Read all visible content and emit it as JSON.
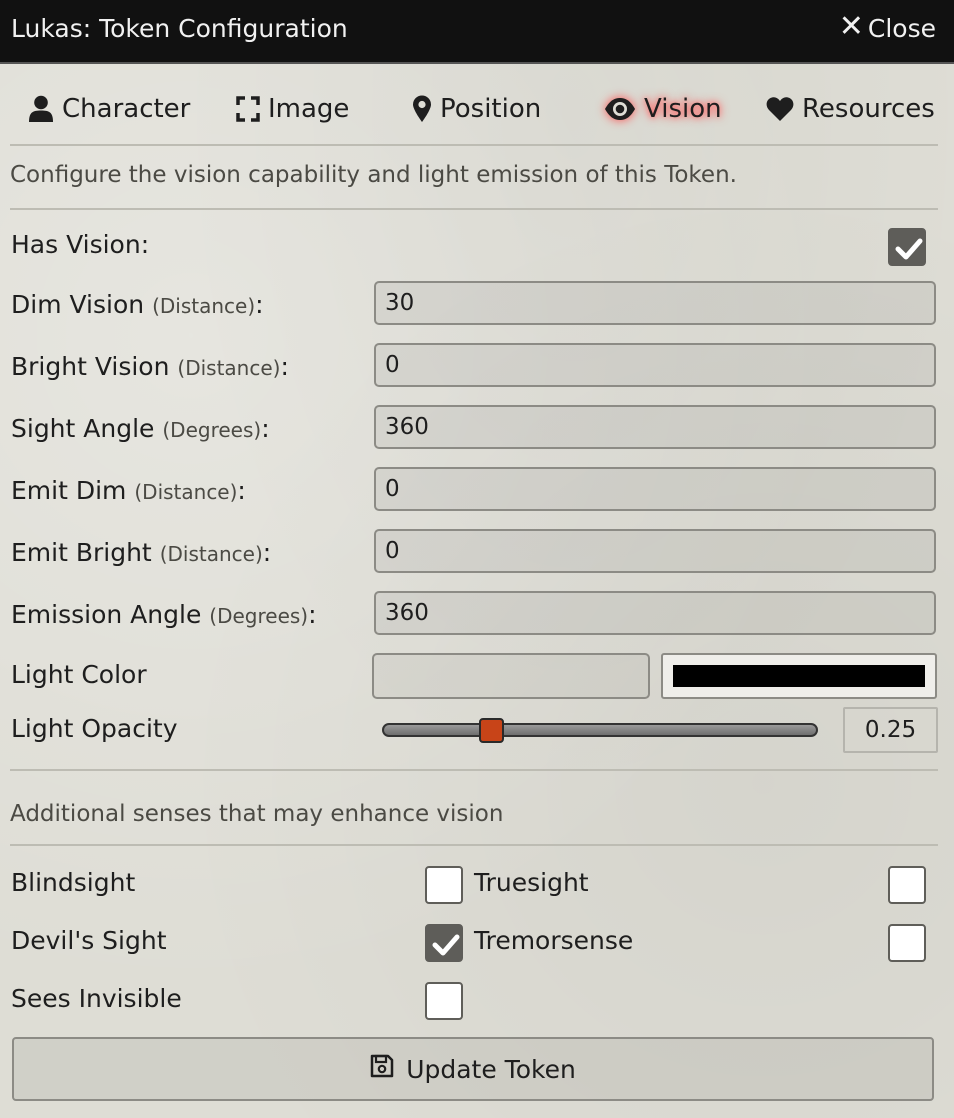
{
  "window": {
    "title": "Lukas: Token Configuration",
    "close_label": "Close"
  },
  "tabs": [
    {
      "label": "Character",
      "icon": "user-icon"
    },
    {
      "label": "Image",
      "icon": "expand-icon"
    },
    {
      "label": "Position",
      "icon": "map-marker-icon"
    },
    {
      "label": "Vision",
      "icon": "eye-icon",
      "active": true
    },
    {
      "label": "Resources",
      "icon": "heart-icon"
    }
  ],
  "vision": {
    "hint": "Configure the vision capability and light emission of this Token.",
    "has_vision": {
      "label": "Has Vision:",
      "checked": true
    },
    "fields": [
      {
        "label": "Dim Vision",
        "units": "(Distance)",
        "suffix": ":",
        "value": "30"
      },
      {
        "label": "Bright Vision",
        "units": "(Distance)",
        "suffix": ":",
        "value": "0"
      },
      {
        "label": "Sight Angle",
        "units": "(Degrees)",
        "suffix": ":",
        "value": "360"
      },
      {
        "label": "Emit Dim",
        "units": "(Distance)",
        "suffix": ":",
        "value": "0"
      },
      {
        "label": "Emit Bright",
        "units": "(Distance)",
        "suffix": ":",
        "value": "0"
      },
      {
        "label": "Emission Angle",
        "units": "(Degrees)",
        "suffix": ":",
        "value": "360"
      }
    ],
    "light_color": {
      "label": "Light Color",
      "value": "",
      "swatch": "#000000"
    },
    "light_opacity": {
      "label": "Light Opacity",
      "value": "0.25",
      "fraction": 0.25
    }
  },
  "senses": {
    "hint": "Additional senses that may enhance vision",
    "items": [
      {
        "label": "Blindsight",
        "checked": false
      },
      {
        "label": "Truesight",
        "checked": false
      },
      {
        "label": "Devil's Sight",
        "checked": true
      },
      {
        "label": "Tremorsense",
        "checked": false
      },
      {
        "label": "Sees Invisible",
        "checked": false
      }
    ]
  },
  "footer": {
    "update_label": "Update Token",
    "icon": "save-icon"
  },
  "colors": {
    "accent_glow": "#ff4a4a",
    "slider_thumb": "#c84418",
    "titlebar": "#111111"
  }
}
